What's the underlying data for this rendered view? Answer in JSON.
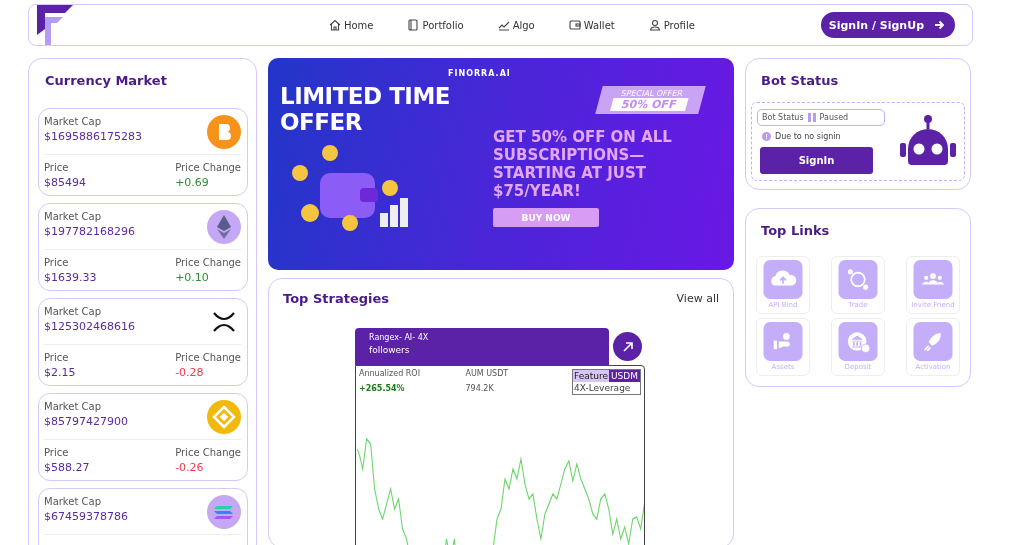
{
  "nav": {
    "items": [
      {
        "label": "Home",
        "kind": "home"
      },
      {
        "label": "Portfolio",
        "kind": "portfolio"
      },
      {
        "label": "Algo",
        "kind": "algo"
      },
      {
        "label": "Wallet",
        "kind": "wallet"
      },
      {
        "label": "Profile",
        "kind": "profile"
      }
    ],
    "signin": "SignIn / SignUp"
  },
  "currency_market": {
    "title": "Currency Market",
    "coins": [
      {
        "kind": "btc",
        "cap_label": "Market Cap",
        "cap": "$1695886175283",
        "price_label": "Price",
        "price": "$85494",
        "change_label": "Price Change",
        "change": "+0.69",
        "color": "#2e8b2e"
      },
      {
        "kind": "eth",
        "cap_label": "Market Cap",
        "cap": "$197782168296",
        "price_label": "Price",
        "price": "$1639.33",
        "change_label": "Price Change",
        "change": "+0.10",
        "color": "#2e8b2e"
      },
      {
        "kind": "xrp",
        "cap_label": "Market Cap",
        "cap": "$125302468616",
        "price_label": "Price",
        "price": "$2.15",
        "change_label": "Price Change",
        "change": "-0.28",
        "color": "#f03a4a"
      },
      {
        "kind": "bnb",
        "cap_label": "Market Cap",
        "cap": "$85797427900",
        "price_label": "Price",
        "price": "$588.27",
        "change_label": "Price Change",
        "change": "-0.26",
        "color": "#f03a4a"
      },
      {
        "kind": "sol",
        "cap_label": "Market Cap",
        "cap": "$67459378786"
      }
    ]
  },
  "banner": {
    "brand": "FINORRA.AI",
    "headline": "LIMITED TIME OFFER",
    "tag_top": "SPECIAL OFFER",
    "tag_bottom": "50% OFF",
    "offer": "GET 50% OFF ON ALL SUBSCRIPTIONS—STARTING AT JUST $75/YEAR!",
    "button": "BUY NOW"
  },
  "top_strategies": {
    "title": "Top Strategies",
    "view_all": "View all",
    "strategy": {
      "name": "Rangex- AI- 4X",
      "followers": "followers",
      "roi_label": "Annualized ROI",
      "roi": "+265.54%",
      "aum_label": "AUM USDT",
      "aum": "794.2K",
      "tag_feature": "Feature",
      "tag_market": "USDM",
      "tag_leverage": "4X-Leverage"
    }
  },
  "bot_status": {
    "title": "Bot Status",
    "status_label": "Bot Status",
    "status": "Paused",
    "note": "Due to no signin",
    "button": "SignIn"
  },
  "top_links": {
    "title": "Top Links",
    "items": [
      {
        "label": "API Bind",
        "kind": "cloud"
      },
      {
        "label": "Trade",
        "kind": "globe"
      },
      {
        "label": "Invite Friend",
        "kind": "people"
      },
      {
        "label": "Assets",
        "kind": "hand"
      },
      {
        "label": "Deposit",
        "kind": "bank"
      },
      {
        "label": "Activation",
        "kind": "rocket"
      }
    ]
  }
}
